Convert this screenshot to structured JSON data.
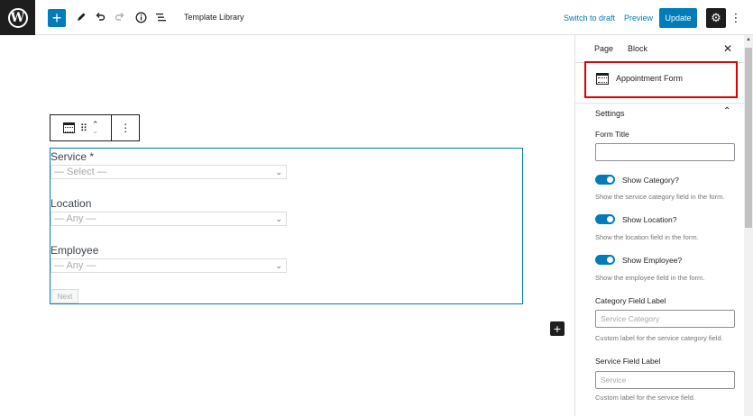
{
  "topbar": {
    "logo_glyph": "W",
    "add_glyph": "+",
    "title": "Template Library",
    "switch_to_draft": "Switch to draft",
    "preview": "Preview",
    "update": "Update",
    "settings_glyph": "⚙",
    "more_glyph": "⋮",
    "accent_color": "#007cba"
  },
  "block_toolbar": {
    "drag_glyph": "⠿",
    "up_glyph": "⌃",
    "down_glyph": "⌄",
    "more_glyph": "⋮"
  },
  "form": {
    "service_label": "Service *",
    "service_placeholder": "— Select —",
    "location_label": "Location",
    "location_placeholder": "— Any —",
    "employee_label": "Employee",
    "employee_placeholder": "— Any —",
    "next_label": "Next",
    "chevron_glyph": "⌄",
    "add_glyph": "+"
  },
  "sidebar": {
    "tab_page": "Page",
    "tab_block": "Block",
    "close_glyph": "✕",
    "block_title": "Appointment Form",
    "highlight_color": "#e00000",
    "panel_title": "Settings",
    "panel_chevron": "⌃",
    "form_title_label": "Form Title",
    "toggles": [
      {
        "label": "Show Category?",
        "help": "Show the service category field in the form.",
        "on": true
      },
      {
        "label": "Show Location?",
        "help": "Show the location field in the form.",
        "on": true
      },
      {
        "label": "Show Employee?",
        "help": "Show the employee field in the form.",
        "on": true
      }
    ],
    "category_field_label": "Category Field Label",
    "category_placeholder": "Service Category",
    "category_help": "Custom label for the service category field.",
    "service_field_label": "Service Field Label",
    "service_placeholder": "Service",
    "service_help": "Custom label for the service field."
  },
  "scrollbar": {
    "up_glyph": "▲"
  }
}
